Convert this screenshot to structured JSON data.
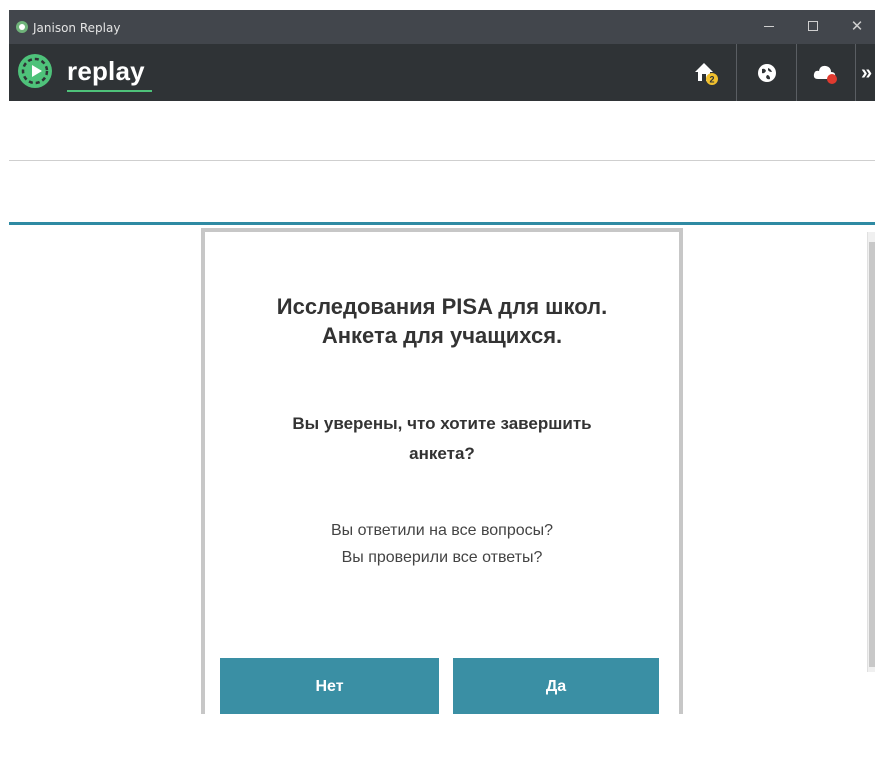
{
  "window": {
    "title": "Janison Replay",
    "close_glyph": "✕"
  },
  "appbar": {
    "logo_text": "replay",
    "more_glyph": "»",
    "icons": [
      "home-icon",
      "globe-icon",
      "cloud-icon"
    ],
    "home_badge": "2",
    "colors": {
      "logo_green": "#4ec27a",
      "badge_yellow": "#f2c12e",
      "cloud_alert": "#e03a2f"
    }
  },
  "colors": {
    "accent_teal": "#2f8aa3",
    "button_teal": "#3a8fa4"
  },
  "dialog": {
    "title_line1": "Исследования PISA для школ.",
    "title_line2": "Анкета для учащихся.",
    "question_line1": "Вы уверены, что хотите завершить",
    "question_line2": "анкета?",
    "check_line1": "Вы ответили на все вопросы?",
    "check_line2": "Вы проверили все ответы?",
    "no_label": "Нет",
    "yes_label": "Да"
  }
}
